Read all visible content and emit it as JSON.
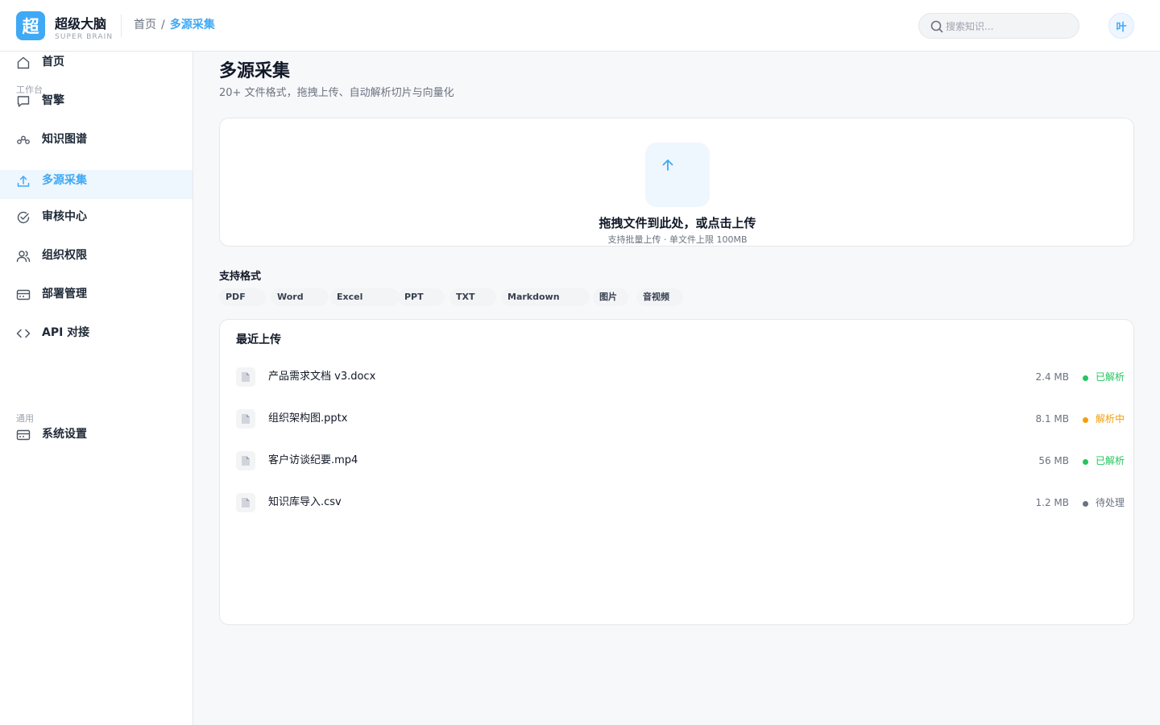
{
  "app": {
    "logo_char": "超",
    "name": "超级大脑",
    "subtitle": "SUPER BRAIN"
  },
  "breadcrumb": {
    "home": "首页",
    "separator": "/",
    "current": "多源采集"
  },
  "search": {
    "placeholder": "搜索知识..."
  },
  "user": {
    "avatar_char": "叶"
  },
  "colors": {
    "accent": "#3fa9f5",
    "parsed": "#22c55e",
    "parsing": "#f59e0b",
    "pending": "#6b7280"
  },
  "sidebar": {
    "groups": {
      "workspace": "工作台",
      "general": "通用"
    },
    "items": [
      {
        "label": "首页",
        "icon": "home-icon"
      },
      {
        "label": "智擎",
        "icon": "chat-icon"
      },
      {
        "label": "知识图谱",
        "icon": "graph-icon"
      },
      {
        "label": "多源采集",
        "icon": "upload-icon",
        "active": true
      },
      {
        "label": "审核中心",
        "icon": "check-circle-icon"
      },
      {
        "label": "组织权限",
        "icon": "users-icon"
      },
      {
        "label": "部署管理",
        "icon": "server-icon"
      },
      {
        "label": "API 对接",
        "icon": "code-icon"
      },
      {
        "label": "系统设置",
        "icon": "settings-icon"
      }
    ]
  },
  "main": {
    "title": "多源采集",
    "subtitle": "20+ 文件格式，拖拽上传、自动解析切片与向量化",
    "upload": {
      "title": "拖拽文件到此处，或点击上传",
      "hint": "支持批量上传 · 单文件上限 100MB"
    },
    "formats": {
      "label": "支持格式",
      "items": [
        "PDF",
        "Word",
        "Excel",
        "PPT",
        "TXT",
        "Markdown",
        "图片",
        "音视频"
      ]
    },
    "recent": {
      "title": "最近上传",
      "files": [
        {
          "name": "产品需求文档 v3.docx",
          "size": "2.4 MB",
          "status": "已解析",
          "state": "parsed"
        },
        {
          "name": "组织架构图.pptx",
          "size": "8.1 MB",
          "status": "解析中",
          "state": "parsing"
        },
        {
          "name": "客户访谈纪要.mp4",
          "size": "56 MB",
          "status": "已解析",
          "state": "parsed"
        },
        {
          "name": "知识库导入.csv",
          "size": "1.2 MB",
          "status": "待处理",
          "state": "pending"
        }
      ]
    }
  }
}
